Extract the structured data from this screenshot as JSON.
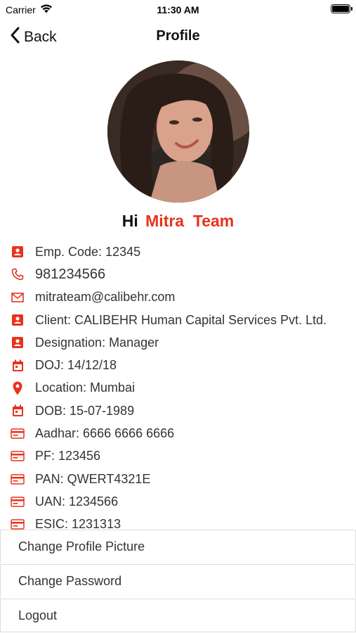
{
  "status_bar": {
    "carrier": "Carrier",
    "time": "11:30 AM"
  },
  "nav": {
    "back_label": "Back",
    "title": "Profile"
  },
  "greeting": {
    "hi": "Hi",
    "name": "Mitra  Team"
  },
  "colors": {
    "accent": "#e8321b"
  },
  "details": [
    {
      "icon": "contact-card-icon",
      "text": "Emp. Code: 12345"
    },
    {
      "icon": "phone-icon",
      "text": "981234566"
    },
    {
      "icon": "mail-icon",
      "text": "mitrateam@calibehr.com"
    },
    {
      "icon": "contact-card-icon",
      "text": "Client: CALIBEHR Human Capital Services Pvt. Ltd."
    },
    {
      "icon": "contact-card-icon",
      "text": "Designation: Manager"
    },
    {
      "icon": "calendar-icon",
      "text": "DOJ: 14/12/18"
    },
    {
      "icon": "location-pin-icon",
      "text": "Location: Mumbai"
    },
    {
      "icon": "calendar-icon",
      "text": "DOB: 15-07-1989"
    },
    {
      "icon": "id-card-icon",
      "text": "Aadhar: 6666 6666 6666"
    },
    {
      "icon": "id-card-icon",
      "text": "PF: 123456"
    },
    {
      "icon": "id-card-icon",
      "text": "PAN: QWERT4321E"
    },
    {
      "icon": "id-card-icon",
      "text": "UAN: 1234566"
    },
    {
      "icon": "id-card-icon",
      "text": "ESIC: 1231313"
    }
  ],
  "menu": {
    "change_picture": "Change Profile Picture",
    "change_password": "Change Password",
    "logout": "Logout"
  }
}
